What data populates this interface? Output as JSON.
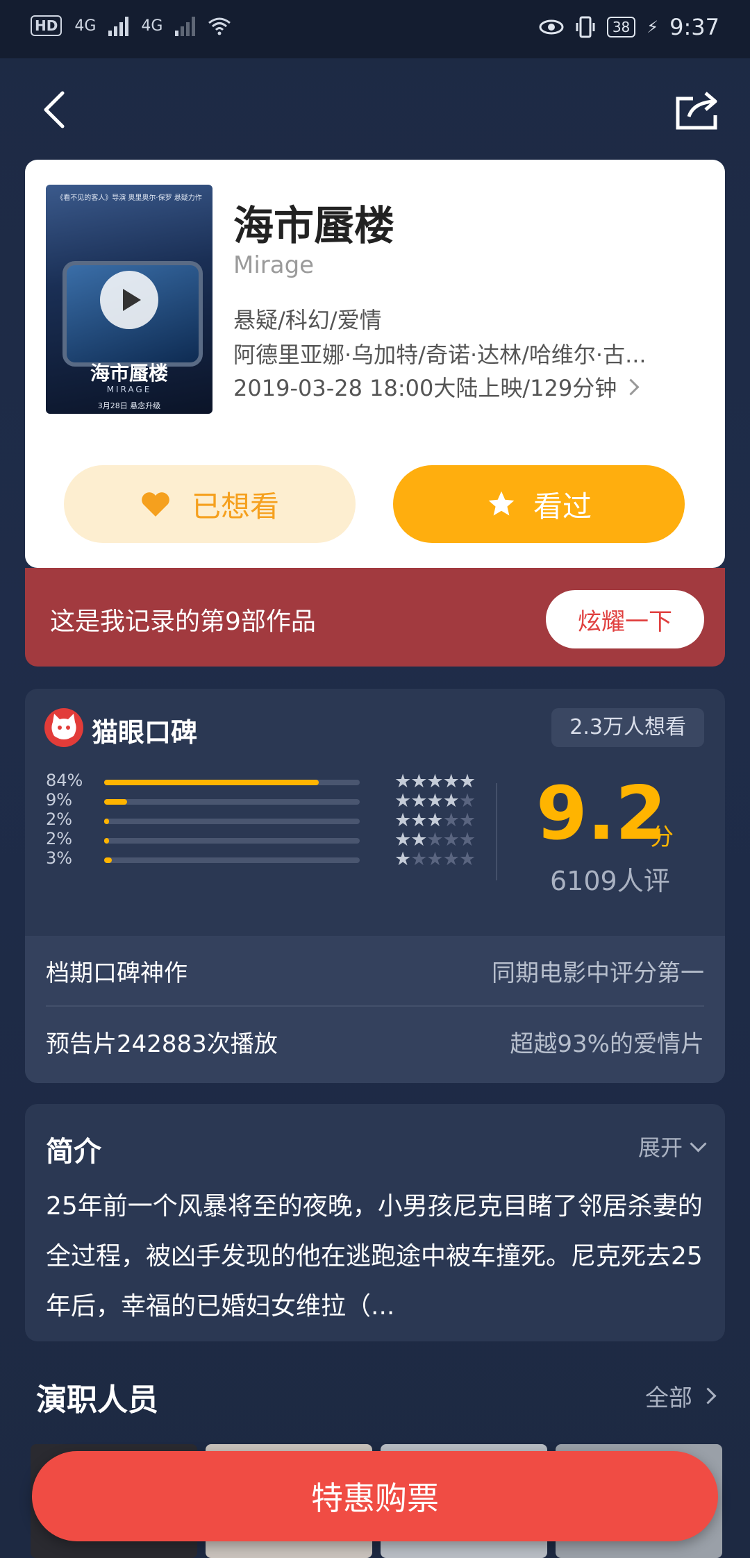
{
  "status_bar": {
    "hd": "HD",
    "net1": "4G",
    "net2": "4G",
    "battery": "38",
    "time": "9:37"
  },
  "movie": {
    "title": "海市蜃楼",
    "english_title": "Mirage",
    "genres": "悬疑/科幻/爱情",
    "cast": "阿德里亚娜·乌加特/奇诺·达林/哈维尔·古...",
    "release": "2019-03-28 18:00大陆上映/129分钟",
    "poster": {
      "top_text": "《看不见的客人》导演 奥里奥尔·保罗 悬疑力作",
      "title": "海市蜃楼",
      "subtitle": "MIRAGE",
      "date": "3月28日 悬念升级"
    }
  },
  "actions": {
    "want_label": "已想看",
    "seen_label": "看过"
  },
  "record": {
    "text": "这是我记录的第9部作品",
    "button": "炫耀一下"
  },
  "rating": {
    "title": "猫眼口碑",
    "want_count": "2.3万人想看",
    "distribution": [
      {
        "pct": "84%",
        "value": 84,
        "stars": 5
      },
      {
        "pct": "9%",
        "value": 9,
        "stars": 4
      },
      {
        "pct": "2%",
        "value": 2,
        "stars": 3
      },
      {
        "pct": "2%",
        "value": 2,
        "stars": 2
      },
      {
        "pct": "3%",
        "value": 3,
        "stars": 1
      }
    ],
    "score": "9.2",
    "score_unit": "分",
    "raters": "6109人评",
    "rows": [
      {
        "left": "档期口碑神作",
        "right": "同期电影中评分第一"
      },
      {
        "left": "预告片242883次播放",
        "right": "超越93%的爱情片"
      }
    ]
  },
  "intro": {
    "title": "简介",
    "expand": "展开",
    "text": "25年前一个风暴将至的夜晚，小男孩尼克目睹了邻居杀妻的全过程，被凶手发现的他在逃跑途中被车撞死。尼克死去25年后，幸福的已婚妇女维拉（..."
  },
  "cast_section": {
    "title": "演职人员",
    "all": "全部"
  },
  "buy_button": "特惠购票",
  "colors": {
    "accent": "#ffb400",
    "buy": "#f04c44",
    "record": "#a23a3f"
  }
}
